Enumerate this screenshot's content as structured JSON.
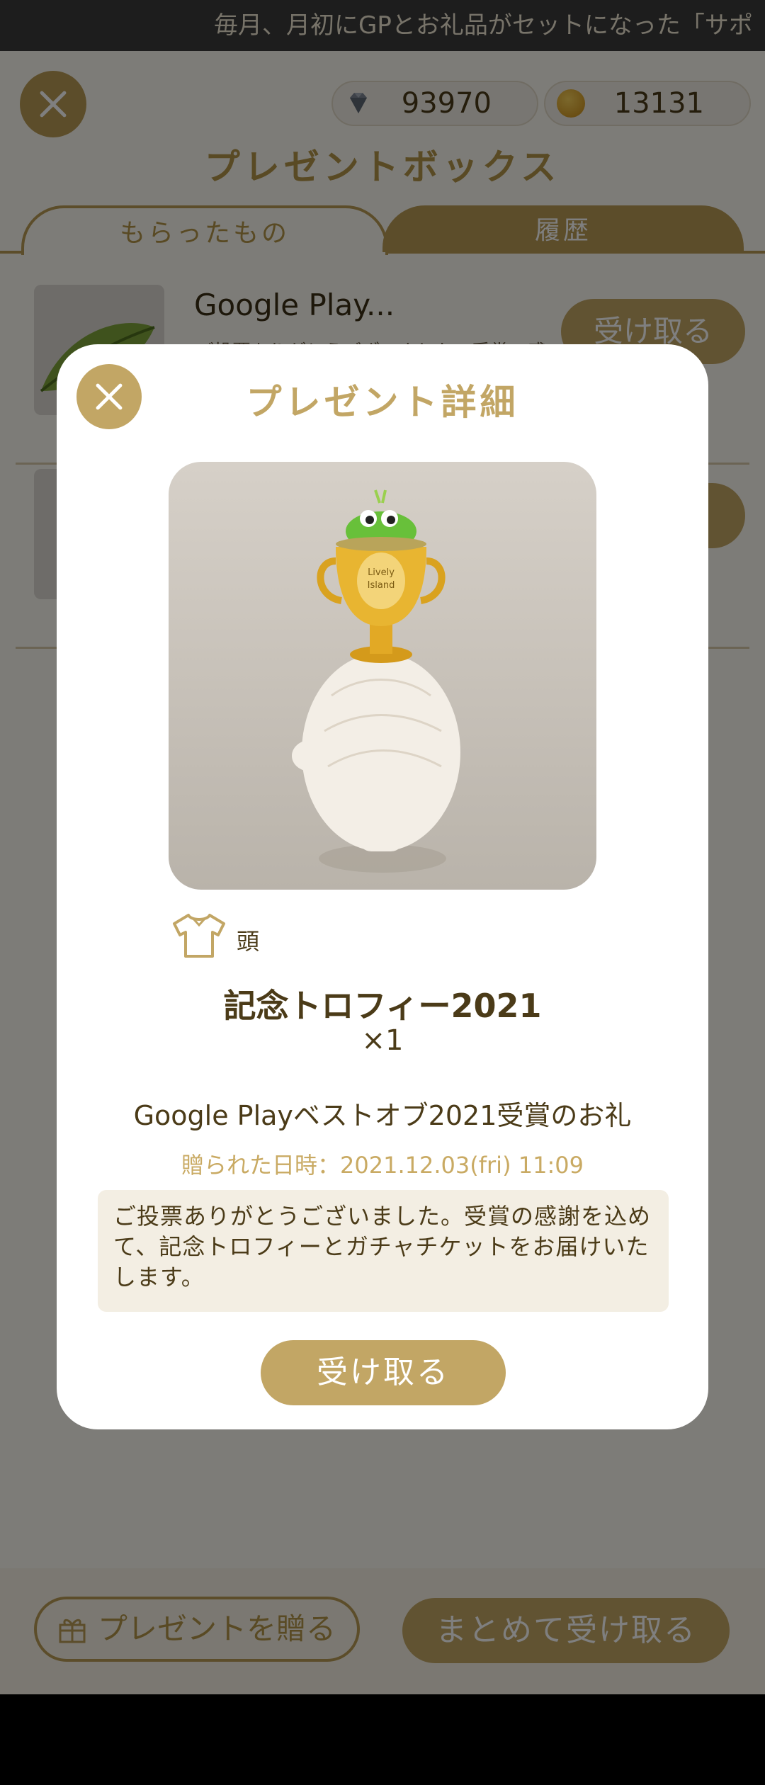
{
  "ticker": {
    "text": "毎月、月初にGPとお礼品がセットになった「サポ"
  },
  "header": {
    "gems": "93970",
    "coins": "13131",
    "title": "プレゼントボックス"
  },
  "tabs": [
    {
      "label": "もらったもの",
      "active": true
    },
    {
      "label": "履歴",
      "active": false
    }
  ],
  "list": [
    {
      "title": "Google Play...",
      "desc": "ご投票ありがとうございました。受賞の感",
      "button": "受け取る"
    },
    {
      "title": "",
      "desc": "",
      "button": ""
    }
  ],
  "bottom": {
    "send_label": "プレゼントを贈る",
    "receive_all_label": "まとめて受け取る"
  },
  "modal": {
    "title": "プレゼント詳細",
    "image_text": "Lively Island",
    "category": "頭",
    "item_name": "記念トロフィー2021",
    "quantity": "×1",
    "present_title": "Google Playベストオブ2021受賞のお礼",
    "date": "贈られた日時：2021.12.03(fri) 11:09",
    "message": "ご投票ありがとうございました。受賞の感謝を込めて、記念トロフィーとガチャチケットをお届けいたします。",
    "receive_label": "受け取る"
  },
  "colors": {
    "accent": "#c2a665",
    "text_dark": "#4b3b18",
    "date_text": "#c9aa63"
  }
}
